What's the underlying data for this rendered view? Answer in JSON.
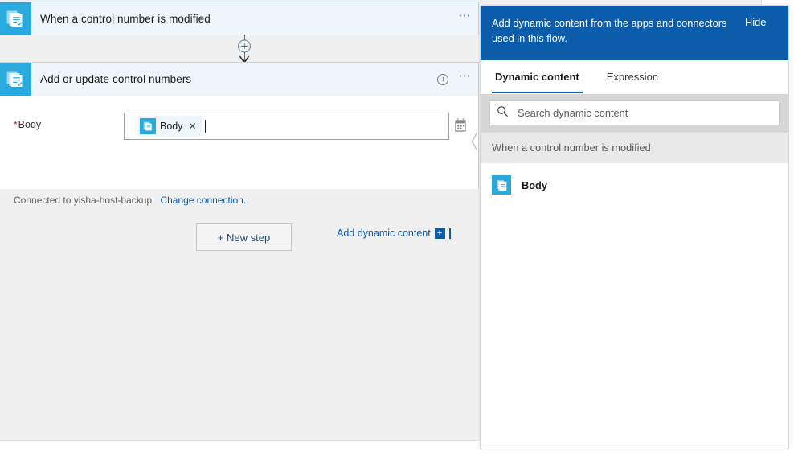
{
  "canvas": {
    "trigger_card": {
      "title": "When a control number is modified",
      "icon": "document-stack-icon",
      "menu_icon": "ellipsis-icon"
    },
    "connector": {
      "add_icon": "plus-circle-icon",
      "arrow_icon": "arrow-down-icon"
    },
    "action_card": {
      "title": "Add or update control numbers",
      "icon": "document-stack-icon",
      "info_icon": "info-icon",
      "menu_icon": "ellipsis-icon",
      "field": {
        "required_marker": "*",
        "label": "Body",
        "token_label": "Body",
        "token_icon": "document-stack-icon",
        "token_remove_icon": "close-icon",
        "picker_icon": "dynamic-content-picker-icon",
        "input_value": ""
      },
      "add_dynamic_content": {
        "label": "Add dynamic content",
        "plus_icon": "plus-icon"
      },
      "connection": {
        "status_text": "Connected to yisha-host-backup.",
        "change_link": "Change connection."
      }
    },
    "new_step_button": "+ New step",
    "collapse_handle_icon": "chevron-left-icon"
  },
  "dynamic_content_panel": {
    "banner": {
      "message": "Add dynamic content from the apps and connectors used in this flow.",
      "hide_label": "Hide"
    },
    "tabs": [
      {
        "label": "Dynamic content",
        "active": true
      },
      {
        "label": "Expression",
        "active": false
      }
    ],
    "search": {
      "placeholder": "Search dynamic content",
      "value": "",
      "icon": "search-icon"
    },
    "group_header": "When a control number is modified",
    "items": [
      {
        "label": "Body",
        "icon": "document-stack-icon"
      }
    ]
  },
  "colors": {
    "accent_blue": "#0b5cab",
    "connector_teal": "#2aa9dd",
    "card_header": "#eef6fb",
    "card_border": "#b9d9e8",
    "canvas_bg": "#f0f0f0",
    "link_blue": "#0a5ca8",
    "required_red": "#a4262c"
  }
}
